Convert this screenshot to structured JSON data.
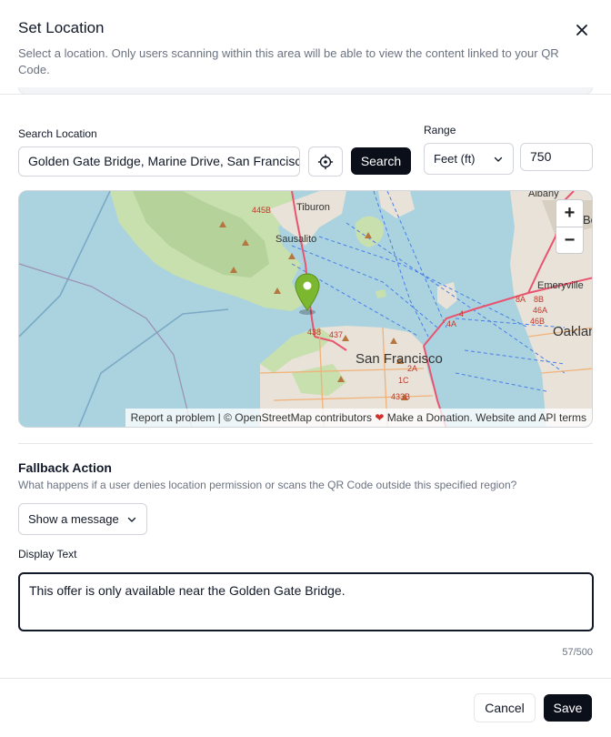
{
  "dialog": {
    "title": "Set Location",
    "subtitle": "Select a location. Only users scanning within this area will be able to view the content linked to your QR Code."
  },
  "search": {
    "label": "Search Location",
    "value": "Golden Gate Bridge, Marine Drive, San Francisco, CA",
    "button_label": "Search"
  },
  "range": {
    "label": "Range",
    "unit_selected": "Feet (ft)",
    "value": "750"
  },
  "map": {
    "zoom_in": "+",
    "zoom_out": "−",
    "attribution": {
      "report": "Report a problem",
      "osm": " | © OpenStreetMap contributors ",
      "donate": " Make a Donation. ",
      "website": "Website and API terms"
    },
    "place_labels": {
      "tiburon": "Tiburon",
      "sausalito": "Sausalito",
      "san_francisco": "San Francisco",
      "emeryville": "Emeryville",
      "albany": "Albany",
      "oakland": "Oaklan",
      "berkeley": "Be"
    },
    "road_labels": [
      "445B",
      "438",
      "437",
      "4A",
      "4",
      "8A",
      "8B",
      "46A",
      "46B",
      "2A",
      "1C",
      "433B",
      "4"
    ],
    "colors": {
      "water": "#aad3df",
      "park": "#c8dfae",
      "urban": "#e8e2d8",
      "marker": "#7cb82f",
      "road": "#e8546f"
    }
  },
  "fallback": {
    "title": "Fallback Action",
    "description": "What happens if a user denies location permission or scans the QR Code outside this specified region?",
    "selected_action": "Show a message",
    "display_text_label": "Display Text",
    "display_text": "This offer is only available near the Golden Gate Bridge.",
    "counter": "57/500"
  },
  "footer": {
    "cancel_label": "Cancel",
    "save_label": "Save"
  }
}
